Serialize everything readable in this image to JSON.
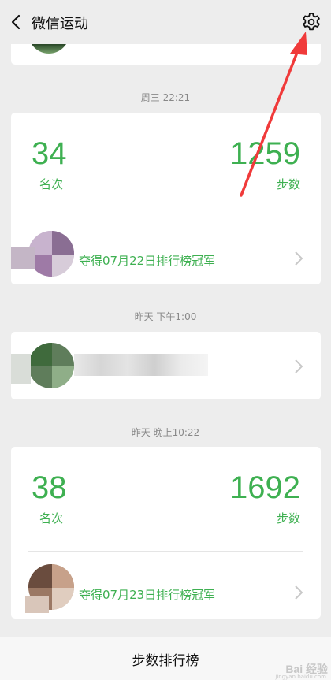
{
  "header": {
    "title": "微信运动"
  },
  "feed": [
    {
      "timestamp": "周三 22:21",
      "rank_value": "34",
      "rank_label": "名次",
      "steps_value": "1259",
      "steps_label": "步数",
      "champion_text": "夺得07月22日排行榜冠军"
    },
    {
      "timestamp": "昨天 下午1:00"
    },
    {
      "timestamp": "昨天 晚上10:22",
      "rank_value": "38",
      "rank_label": "名次",
      "steps_value": "1692",
      "steps_label": "步数",
      "champion_text": "夺得07月23日排行榜冠军"
    }
  ],
  "footer": {
    "leaderboard_label": "步数排行榜"
  },
  "watermark": {
    "text": "Bai 经验",
    "sub": "jingyan.baidu.com"
  },
  "colors": {
    "accent": "#3eb051",
    "background": "#ededed",
    "annotation_arrow": "#f03a3a"
  }
}
